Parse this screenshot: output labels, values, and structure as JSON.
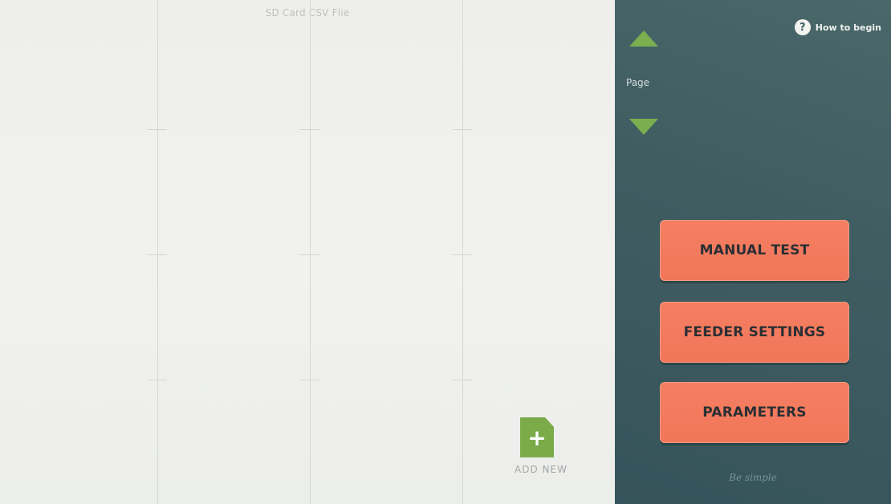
{
  "grid": {
    "header_label": "SD Card CSV Flie",
    "add_new_label": "ADD  NEW",
    "add_new_glyph": "+"
  },
  "controls": {
    "page_label": "Page",
    "help_label": "How to begin",
    "help_glyph": "?",
    "buttons": {
      "manual_test": "MANUAL TEST",
      "feeder_settings": "FEEDER SETTINGS",
      "parameters": "PARAMETERS"
    },
    "footer_note": "Be simple"
  },
  "colors": {
    "panel": "#3f5d61",
    "accent_green": "#7aae4f",
    "button_orange": "#f47f62",
    "grid_background": "#efefed"
  },
  "icons": {
    "page_up": "triangle-up-icon",
    "page_down": "triangle-down-icon",
    "help": "question-circle-icon",
    "add_new": "file-plus-icon"
  }
}
